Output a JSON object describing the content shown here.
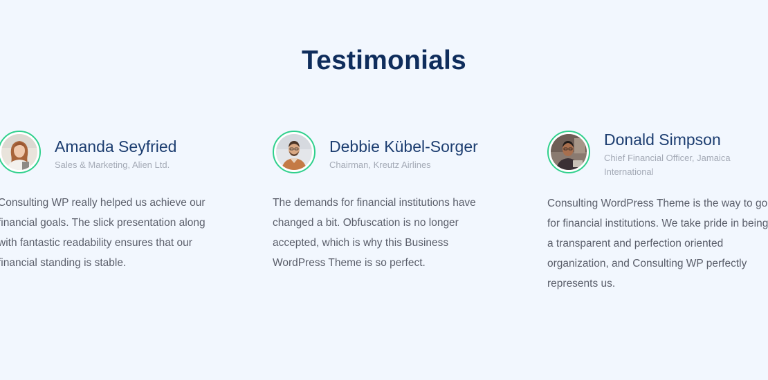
{
  "section": {
    "title": "Testimonials"
  },
  "testimonials": [
    {
      "name": "Amanda Seyfried",
      "role": "Sales & Marketing, Alien Ltd.",
      "quote": "Consulting WP really helped us achieve our financial goals. The slick presentation along with fantastic readability ensures that our financial standing is stable."
    },
    {
      "name": "Debbie Kübel-Sorger",
      "role": "Chairman, Kreutz Airlines",
      "quote": "The demands for financial institutions have changed a bit. Obfuscation is no longer accepted, which is why this Business WordPress Theme is so perfect."
    },
    {
      "name": "Donald Simpson",
      "role": "Chief Financial Officer, Jamaica International",
      "quote": "Consulting WordPress Theme is the way to go for financial institutions. We take pride in being a transparent and perfection oriented organization, and Consulting WP perfectly represents us."
    }
  ],
  "colors": {
    "background": "#f2f7fe",
    "title": "#0f2d5c",
    "name": "#1c3d70",
    "avatar_ring": "#2fd08c",
    "body_text": "#5a5e6a",
    "muted_text": "#a4aab6"
  }
}
